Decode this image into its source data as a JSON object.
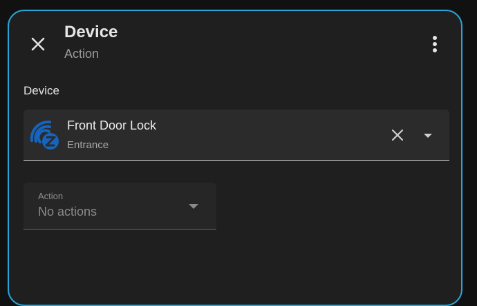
{
  "dialog": {
    "title": "Device",
    "subtitle": "Action",
    "accent_color": "#2aa3d6",
    "close_icon": "close-icon",
    "menu_icon": "dots-vertical-icon"
  },
  "device_section": {
    "label": "Device",
    "selected_device": {
      "name": "Front Door Lock",
      "area": "Entrance",
      "icon": "zwave-icon",
      "icon_color": "#1565c0"
    },
    "clear_icon": "close-icon",
    "dropdown_icon": "menu-down-icon"
  },
  "action_field": {
    "label": "Action",
    "value": "No actions",
    "dropdown_icon": "menu-down-icon"
  }
}
